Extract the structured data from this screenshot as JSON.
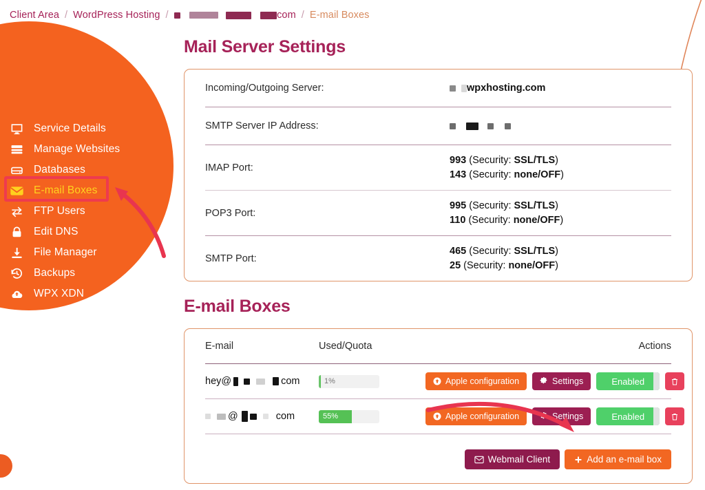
{
  "breadcrumb": {
    "items": [
      {
        "label": "Client Area",
        "type": "link"
      },
      {
        "label": "WordPress Hosting",
        "type": "link"
      },
      {
        "label": "com",
        "type": "redacted-domain"
      },
      {
        "label": "E-mail Boxes",
        "type": "current"
      }
    ],
    "separator": "/"
  },
  "sidebar": {
    "items": [
      {
        "label": "Service Details",
        "icon": "monitor-icon",
        "active": false
      },
      {
        "label": "Manage Websites",
        "icon": "server-icon",
        "active": false
      },
      {
        "label": "Databases",
        "icon": "hard-drive-icon",
        "active": false
      },
      {
        "label": "E-mail Boxes",
        "icon": "envelope-icon",
        "active": true
      },
      {
        "label": "FTP Users",
        "icon": "exchange-arrows-icon",
        "active": false
      },
      {
        "label": "Edit DNS",
        "icon": "lock-icon",
        "active": false
      },
      {
        "label": "File Manager",
        "icon": "download-icon",
        "active": false
      },
      {
        "label": "Backups",
        "icon": "history-icon",
        "active": false
      },
      {
        "label": "WPX XDN",
        "icon": "cloud-upload-icon",
        "active": false
      }
    ]
  },
  "mail_server": {
    "title": "Mail Server Settings",
    "rows": [
      {
        "label": "Incoming/Outgoing Server:",
        "value_suffix": "wpxhosting.com",
        "redacted": true,
        "kind": "server"
      },
      {
        "label": "SMTP Server IP Address:",
        "value_suffix": "",
        "redacted": true,
        "kind": "ip"
      },
      {
        "label": "IMAP Port:",
        "kind": "ports",
        "ports": [
          {
            "port": "993",
            "security_label": "(Security: ",
            "security": "SSL/TLS",
            "close": ")"
          },
          {
            "port": "143",
            "security_label": "(Security: ",
            "security": "none/OFF",
            "close": ")"
          }
        ]
      },
      {
        "label": "POP3 Port:",
        "kind": "ports",
        "ports": [
          {
            "port": "995",
            "security_label": "(Security: ",
            "security": "SSL/TLS",
            "close": ")"
          },
          {
            "port": "110",
            "security_label": "(Security: ",
            "security": "none/OFF",
            "close": ")"
          }
        ]
      },
      {
        "label": "SMTP Port:",
        "kind": "ports",
        "ports": [
          {
            "port": "465",
            "security_label": "(Security: ",
            "security": "SSL/TLS",
            "close": ")"
          },
          {
            "port": "25",
            "security_label": "(Security: ",
            "security": "none/OFF",
            "close": ")"
          }
        ]
      }
    ]
  },
  "email_boxes": {
    "title": "E-mail Boxes",
    "columns": {
      "email": "E-mail",
      "quota": "Used/Quota",
      "actions": "Actions"
    },
    "rows": [
      {
        "email_prefix": "hey@",
        "email_suffix": "com",
        "redacted": true,
        "quota_percent": 1,
        "quota_label": "1%",
        "apple_label": "Apple configuration",
        "settings_label": "Settings",
        "status_label": "Enabled",
        "delete_label": "Delete"
      },
      {
        "email_prefix": "",
        "email_suffix": "com",
        "redacted": true,
        "quota_percent": 55,
        "quota_label": "55%",
        "apple_label": "Apple configuration",
        "settings_label": "Settings",
        "status_label": "Enabled",
        "delete_label": "Delete"
      }
    ],
    "footer": {
      "webmail_label": "Webmail Client",
      "add_label": "Add an e-mail box"
    }
  },
  "colors": {
    "brand_orange": "#f4621f",
    "heading_magenta": "#a62258",
    "accent_gold": "#ffd21e",
    "annotation_red": "#ee3b4f",
    "status_green": "#4fd06a",
    "settings_maroon": "#9c1f52",
    "danger_red": "#e8415c",
    "card_border": "#e09468"
  }
}
